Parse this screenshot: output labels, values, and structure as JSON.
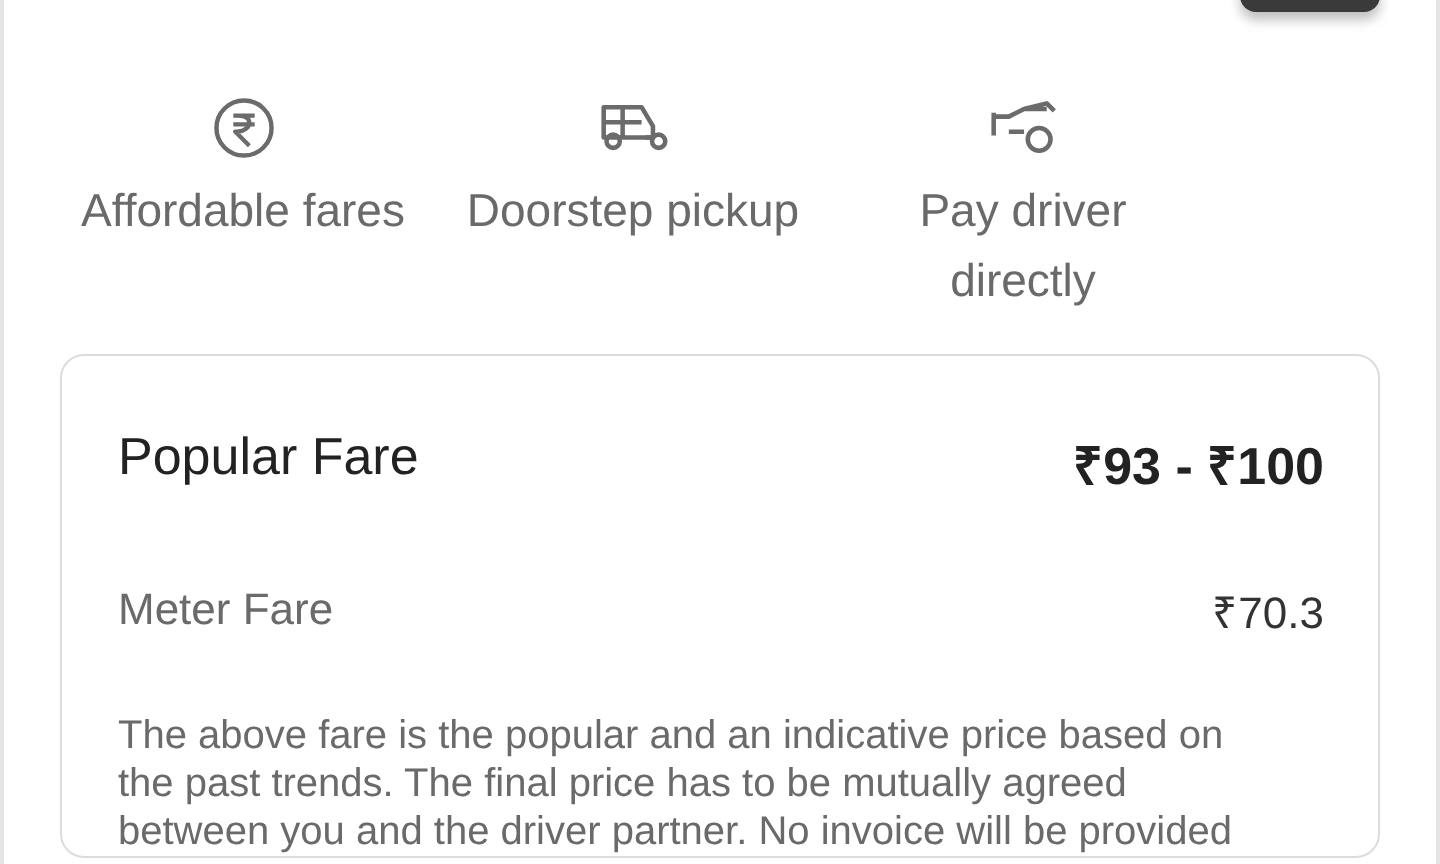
{
  "features": [
    {
      "kind": "rupee",
      "label": "Affordable fares"
    },
    {
      "kind": "auto",
      "label": "Doorstep pickup"
    },
    {
      "kind": "cash",
      "label": "Pay driver directly"
    }
  ],
  "fare_card": {
    "title": "Popular Fare",
    "price": "₹93 - ₹100",
    "meter_label": "Meter Fare",
    "meter_value": "₹70.3",
    "note": "The above fare is the popular and an indicative price based on the past trends. The final price has to be mutually agreed between you and the driver partner. No invoice will be provided"
  }
}
